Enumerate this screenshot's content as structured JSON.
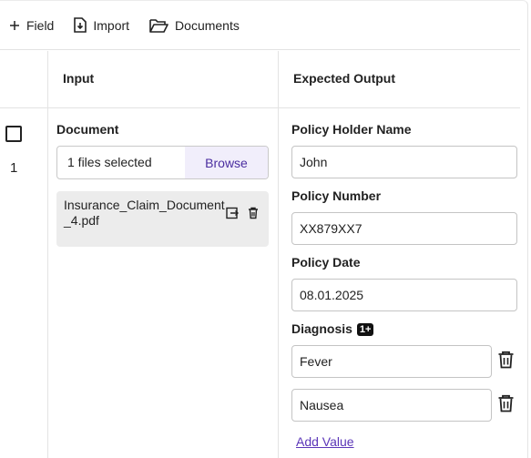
{
  "toolbar": {
    "field_label": "Field",
    "import_label": "Import",
    "documents_label": "Documents"
  },
  "table": {
    "col_input": "Input",
    "col_expected": "Expected Output"
  },
  "row": {
    "number": "1",
    "checked": false
  },
  "input_panel": {
    "document_label": "Document",
    "files_selected": "1 files selected",
    "browse_label": "Browse",
    "file_name": "Insurance_Claim_Document_4.pdf"
  },
  "output_panel": {
    "holder_label": "Policy Holder Name",
    "holder_value": "John",
    "number_label": "Policy Number",
    "number_value": "XX879XX7",
    "date_label": "Policy Date",
    "date_value": "08.01.2025",
    "diagnosis_label": "Diagnosis",
    "diagnosis_badge": "1+",
    "diagnosis_values": [
      "Fever",
      "Nausea"
    ],
    "add_value_label": "Add Value"
  },
  "colors": {
    "accent": "#5b36b8",
    "browse_bg": "#f1eefb",
    "chip_bg": "#ececec"
  }
}
